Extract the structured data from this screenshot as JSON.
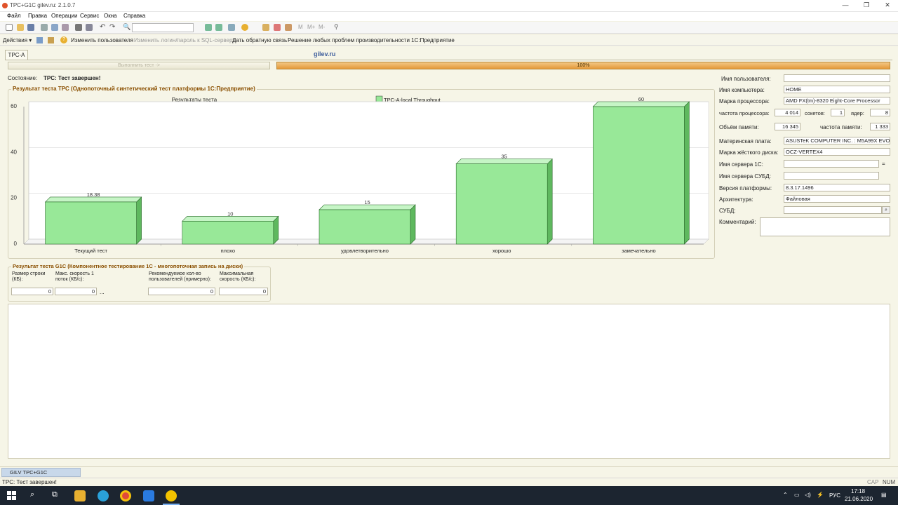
{
  "window": {
    "title": "ТРС+G1C gilev.ru: 2.1.0.7"
  },
  "menu": [
    "Файл",
    "Правка",
    "Операции",
    "Сервис",
    "Окна",
    "Справка"
  ],
  "actions": {
    "menu": "Действия ▾",
    "change_user": "Изменить пользователя",
    "change_login": "Изменить логин/пароль к SQL-серверу",
    "feedback": "Дать обратную связь",
    "solutions": "Решение любых проблем производительности 1С:Предприятие"
  },
  "form": {
    "tab": "TPC-A",
    "site": "gilev.ru",
    "run_button": "Выполнить тест ->",
    "progress_text": "100%",
    "progress_value": 100,
    "state_label": "Состояние:",
    "state_value": "TPC: Тест завершен!"
  },
  "tpc_group": {
    "title": "Результат теста TPC (Однопоточный синтетический тест платформы 1С:Предприятие)"
  },
  "chart_data": {
    "type": "bar",
    "title": "Результаты теста",
    "categories": [
      "Текущий тест",
      "плохо",
      "удовлетворительно",
      "хорошо",
      "замечательно"
    ],
    "series": [
      {
        "name": "TPC-A-local Throughput",
        "values": [
          18.38,
          10,
          15,
          35,
          60
        ]
      }
    ],
    "value_labels": [
      "18.38",
      "10",
      "15",
      "35",
      "60"
    ],
    "y_ticks": [
      "0",
      "20",
      "40",
      "60"
    ],
    "ylim": [
      0,
      60
    ],
    "grid": true,
    "legend": "top-center",
    "bar_color": "#98e898"
  },
  "g1c_group": {
    "title": "Результат теста G1C (Компонентное тестирование 1С - многопоточная запись на диски)",
    "row_size_label": "Размер строки (КБ):",
    "max_speed_1_label": "Макс. скорость 1 поток (КБ/с):",
    "users_label": "Рекомендуемое кол-во пользователей (примерно):",
    "max_speed_label": "Максимальная скорость (КБ/с):",
    "row_size": "0",
    "max_speed_1": "0",
    "users": "0",
    "max_speed": "0",
    "ellipsis": "..."
  },
  "info": {
    "user_label": "Имя пользователя:",
    "user_value": "",
    "computer_label": "Имя компьютера:",
    "computer_value": "HOME",
    "cpu_label": "Марка процессора:",
    "cpu_value": "AMD FX(tm)-8320 Eight-Core Processor",
    "freq_label": "частота процессора:",
    "freq_value": "4 014",
    "sockets_label": "сокетов:",
    "sockets_value": "1",
    "cores_label": "ядер:",
    "cores_value": "8",
    "mem_label": "Объём памяти:",
    "mem_value": "16 345",
    "mem_freq_label": "частота памяти:",
    "mem_freq_value": "1 333",
    "board_label": "Материнская плата:",
    "board_value": "ASUSTeK COMPUTER INC. : M5A99X EVO",
    "disk_label": "Марка жёсткого диска:",
    "disk_value": "OCZ-VERTEX4",
    "server1c_label": "Имя сервера 1С:",
    "server1c_value": "",
    "dbserver_label": "Имя сервера СУБД:",
    "dbserver_value": "",
    "platform_label": "Версия платформы:",
    "platform_value": "8.3.17.1496",
    "arch_label": "Архитектура:",
    "arch_value": "Файловая",
    "dbms_label": "СУБД:",
    "dbms_value": "",
    "comment_label": "Комментарий:",
    "comment_value": ""
  },
  "window_list": {
    "item": "GILV TPC+G1C"
  },
  "status": {
    "text": "TPC: Тест завершен!",
    "cap": "CAP",
    "num": "NUM"
  },
  "taskbar": {
    "lang": "РУС",
    "time": "17:18",
    "date": "21.06.2020"
  }
}
